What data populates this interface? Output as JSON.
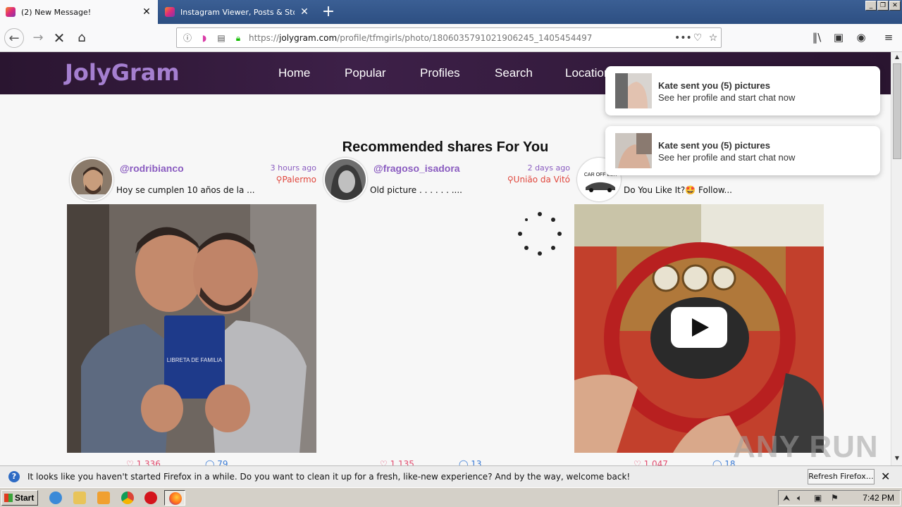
{
  "browser": {
    "tabs": [
      {
        "title": "(2) New Message!",
        "active": true
      },
      {
        "title": "Instagram Viewer, Posts & Story &",
        "active": false
      }
    ],
    "new_tab_label": "+",
    "url_prefix": "https://",
    "url_host": "jolygram.com",
    "url_path": "/profile/tfmgirls/photo/1806035791021906245_1405454497",
    "more_label": "•••"
  },
  "site": {
    "logo": "JolyGram",
    "menu": [
      "Home",
      "Popular",
      "Profiles",
      "Search",
      "Locations"
    ],
    "section_title": "Recommended shares For You"
  },
  "posts": [
    {
      "username": "@rodribianco",
      "time": "3 hours ago",
      "place": "Palermo",
      "caption": "Hoy se cumplen 10 años de la ..."
    },
    {
      "username": "@fragoso_isadora",
      "time": "2 days ago",
      "place": "União da Vitó",
      "caption": "Old picture   . . . . . . ...."
    },
    {
      "username": "",
      "time": "",
      "place": "",
      "caption": "Do You Like It?🤩 Follow...",
      "avatar_label": "CAR OFF LUX"
    }
  ],
  "toasts": [
    {
      "title": "Kate sent you (5) pictures",
      "body": "See her profile and start chat now"
    },
    {
      "title": "Kate sent you (5) pictures",
      "body": "See her profile and start chat now"
    }
  ],
  "notification": {
    "message": "It looks like you haven't started Firefox in a while. Do you want to clean it up for a fresh, like-new experience? And by the way, welcome back!",
    "button": "Refresh Firefox…"
  },
  "watermark": "ANY RUN",
  "taskbar": {
    "start_label": "Start",
    "clock": "7:42 PM"
  },
  "colors": {
    "accent": "#8a5cc0",
    "header_bg": "#2f1838",
    "location_red": "#e0463c"
  }
}
